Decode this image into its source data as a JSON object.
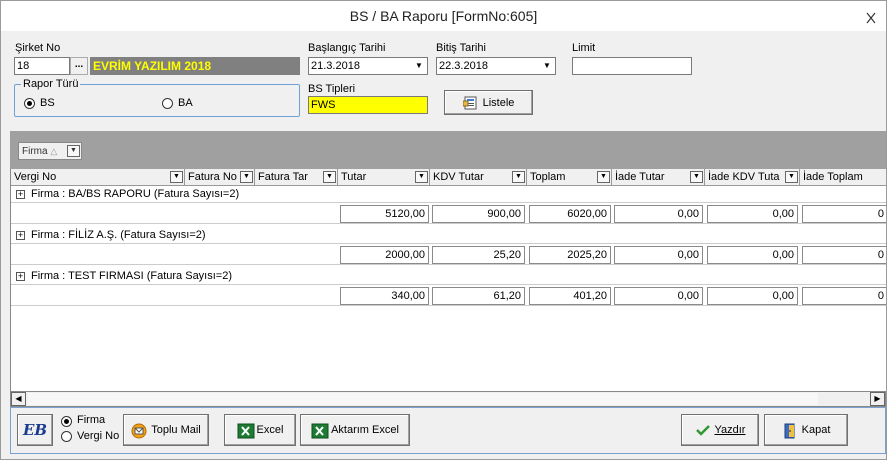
{
  "window": {
    "title": "BS / BA Raporu [FormNo:605]"
  },
  "filters": {
    "company_label": "Şirket No",
    "company_no": "18",
    "company_lookup": "...",
    "company_name": "EVRİM YAZILIM 2018",
    "start_label": "Başlangıç Tarihi",
    "start_date": "21.3.2018",
    "end_label": "Bitiş Tarihi",
    "end_date": "22.3.2018",
    "limit_label": "Limit",
    "limit_value": "",
    "report_type_label": "Rapor Türü",
    "report_type_options": [
      "BS",
      "BA"
    ],
    "report_type_selected": "BS",
    "bs_types_label": "BS Tipleri",
    "bs_types_value": "FWS",
    "list_button": "Listele"
  },
  "grouping": {
    "chip_label": "Firma",
    "sort_indicator": "△"
  },
  "table": {
    "columns": [
      "Vergi No",
      "Fatura No",
      "Fatura Tar",
      "Tutar",
      "KDV Tutar",
      "Toplam",
      "İade Tutar",
      "İade KDV Tuta",
      "İade Toplam"
    ],
    "groups": [
      {
        "label": "Firma : BA/BS RAPORU (Fatura Sayısı=2)",
        "values": [
          "5120,00",
          "900,00",
          "6020,00",
          "0,00",
          "0,00",
          "0"
        ]
      },
      {
        "label": "Firma : FİLİZ A.Ş. (Fatura Sayısı=2)",
        "values": [
          "2000,00",
          "25,20",
          "2025,20",
          "0,00",
          "0,00",
          "0"
        ]
      },
      {
        "label": "Firma : TEST FIRMASI (Fatura Sayısı=2)",
        "values": [
          "340,00",
          "61,20",
          "401,20",
          "0,00",
          "0,00",
          "0"
        ]
      }
    ]
  },
  "footer": {
    "logo_text": "EB",
    "group_by_options": [
      "Firma",
      "Vergi No"
    ],
    "group_by_selected": "Firma",
    "bulk_mail_button": "Toplu Mail",
    "excel_button": "Excel",
    "export_excel_button": "Aktarım Excel",
    "print_button": "Yazdır",
    "close_button": "Kapat"
  },
  "colors": {
    "company_name_text": "#ffff00",
    "company_name_bg": "#808080",
    "bs_types_bg": "#ffff00",
    "group_band": "#a0a0a0",
    "accent_border": "#6fa1d8"
  },
  "icons": {
    "close": "close-icon",
    "list": "list-icon",
    "mail": "mail-icon",
    "excel": "excel-icon",
    "print": "checkmark-icon",
    "exit": "door-icon"
  }
}
